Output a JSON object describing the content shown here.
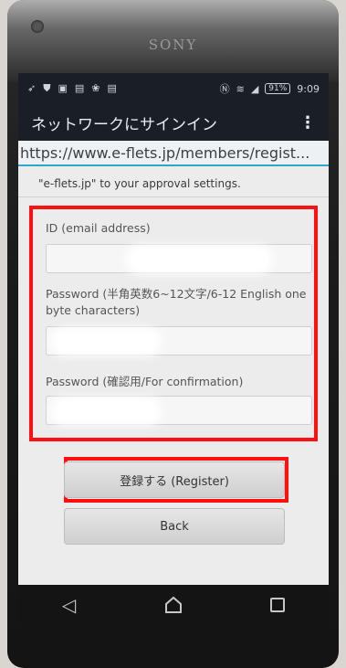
{
  "device": {
    "brand": "SONY"
  },
  "status_bar": {
    "battery": "91%",
    "time": "9:09",
    "icons_left": [
      "signal-icon",
      "shield-icon",
      "image-icon",
      "notification-icon",
      "settings-icon",
      "notification-icon"
    ],
    "icons_right": [
      "nfc-icon",
      "wifi-icon",
      "cell-signal-icon"
    ]
  },
  "action_bar": {
    "title": "ネットワークにサインイン",
    "overflow": "⋮"
  },
  "url": "https://www.e-flets.jp/members/regist...",
  "approval_note": "\"e-flets.jp\" to your approval settings.",
  "form": {
    "id_label": "ID (email address)",
    "password_label": "Password (半角英数6~12文字/6-12 English one byte characters)",
    "confirm_label": "Password (確認用/For confirmation)"
  },
  "buttons": {
    "register": "登録する (Register)",
    "back": "Back"
  },
  "colors": {
    "highlight": "#ff0f0f",
    "url_underline": "#2fa5c7",
    "bar_bg": "#1a1e27"
  }
}
